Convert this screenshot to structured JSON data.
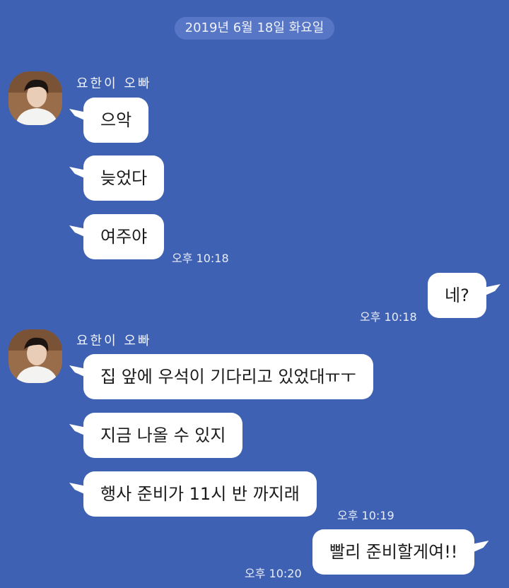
{
  "date_separator": "2019년 6월 18일 화요일",
  "groups": [
    {
      "sender": "요한이 오빠",
      "messages": [
        "으악",
        "늦었다",
        "여주야"
      ],
      "time": "오후 10:18"
    },
    {
      "outgoing": true,
      "messages": [
        "네?"
      ],
      "time": "오후 10:18"
    },
    {
      "sender": "요한이 오빠",
      "messages": [
        "집 앞에 우석이 기다리고 있었대ㅠㅜ",
        "지금 나올 수 있지",
        "행사 준비가 11시 반 까지래"
      ],
      "time": "오후 10:19"
    },
    {
      "outgoing": true,
      "messages": [
        "빨리 준비할게여!!"
      ],
      "time": "오후 10:20"
    }
  ],
  "colors": {
    "background": "#3f61b3",
    "date_pill": "#5876c6",
    "bubble": "#ffffff"
  },
  "icons": [
    "avatar-image"
  ]
}
